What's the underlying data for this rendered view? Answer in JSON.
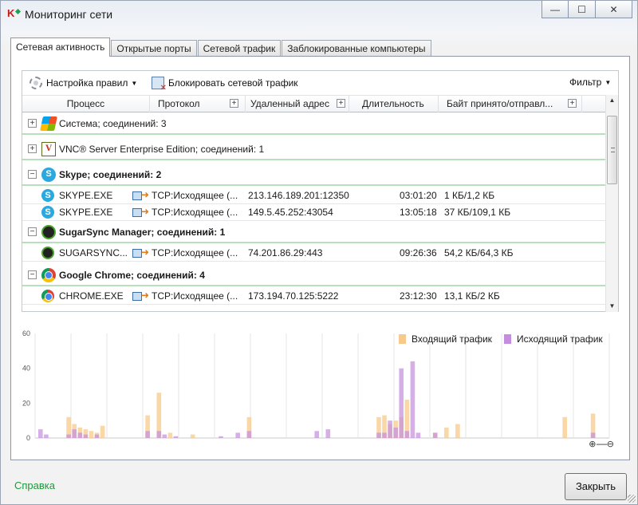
{
  "window": {
    "title": "Мониторинг сети",
    "controls": {
      "minimize": "—",
      "maximize": "☐",
      "close": "✕"
    }
  },
  "tabs": [
    {
      "label": "Сетевая активность",
      "active": true
    },
    {
      "label": "Открытые порты",
      "active": false
    },
    {
      "label": "Сетевой трафик",
      "active": false
    },
    {
      "label": "Заблокированные компьютеры",
      "active": false
    }
  ],
  "toolbar": {
    "rules_label": "Настройка правил",
    "block_label": "Блокировать сетевой трафик",
    "filter_label": "Фильтр"
  },
  "columns": {
    "process": "Процесс",
    "protocol": "Протокол",
    "remote": "Удаленный адрес",
    "duration": "Длительность",
    "bytes": "Байт принято/отправл..."
  },
  "groups": [
    {
      "name": "Система; соединений: 3",
      "icon": "windows-icon",
      "expanded": false
    },
    {
      "name": "VNC® Server Enterprise Edition; соединений: 1",
      "icon": "vnc-icon",
      "expanded": false
    },
    {
      "name": "Skype; соединений: 2",
      "icon": "skype-icon",
      "expanded": true
    },
    {
      "name": "SugarSync Manager; соединений: 1",
      "icon": "sugarsync-icon",
      "expanded": true
    },
    {
      "name": "Google Chrome; соединений: 4",
      "icon": "chrome-icon",
      "expanded": true
    }
  ],
  "connections": [
    {
      "process": "SKYPE.EXE",
      "protocol": "TCP:Исходящее (...",
      "remote": "213.146.189.201:12350",
      "duration": "03:01:20",
      "bytes": "1 КБ/1,2 КБ",
      "icon": "skype-icon"
    },
    {
      "process": "SKYPE.EXE",
      "protocol": "TCP:Исходящее (...",
      "remote": "149.5.45.252:43054",
      "duration": "13:05:18",
      "bytes": "37 КБ/109,1 КБ",
      "icon": "skype-icon"
    },
    {
      "process": "SUGARSYNC...",
      "protocol": "TCP:Исходящее (...",
      "remote": "74.201.86.29:443",
      "duration": "09:26:36",
      "bytes": "54,2 КБ/64,3 КБ",
      "icon": "sugarsync-icon"
    },
    {
      "process": "CHROME.EXE",
      "protocol": "TCP:Исходящее (...",
      "remote": "173.194.70.125:5222",
      "duration": "23:12:30",
      "bytes": "13,1 КБ/2 КБ",
      "icon": "chrome-icon"
    }
  ],
  "chart_data": {
    "type": "bar",
    "title": "",
    "xlabel": "",
    "ylabel": "",
    "ylim": [
      0,
      60
    ],
    "yticks": [
      "0",
      "20",
      "40",
      "60"
    ],
    "grid": true,
    "legend_position": "top-right",
    "series": [
      {
        "name": "Входящий трафик",
        "color": "#f7c98a",
        "values": [
          0,
          0,
          0,
          0,
          0,
          12,
          8,
          6,
          5,
          4,
          3,
          7,
          0,
          0,
          0,
          0,
          0,
          0,
          0,
          13,
          0,
          26,
          0,
          3,
          0,
          0,
          0,
          2,
          0,
          0,
          0,
          0,
          0,
          0,
          0,
          0,
          0,
          12,
          0,
          0,
          0,
          0,
          0,
          0,
          0,
          0,
          0,
          0,
          0,
          0,
          0,
          0,
          0,
          0,
          0,
          0,
          0,
          0,
          0,
          0,
          12,
          13,
          8,
          10,
          12,
          22,
          0,
          0,
          0,
          0,
          3,
          0,
          6,
          0,
          8,
          0,
          0,
          0,
          0,
          0,
          0,
          0,
          0,
          0,
          0,
          0,
          0,
          0,
          0,
          0,
          0,
          0,
          0,
          12,
          0,
          0,
          0,
          0,
          14,
          0,
          0
        ]
      },
      {
        "name": "Исходящий трафик",
        "color": "#c48de0",
        "values": [
          5,
          2,
          0,
          0,
          0,
          2,
          5,
          3,
          2,
          0,
          2,
          0,
          0,
          0,
          0,
          0,
          0,
          0,
          0,
          4,
          0,
          4,
          2,
          0,
          1,
          0,
          0,
          0,
          0,
          0,
          0,
          0,
          1,
          0,
          0,
          3,
          0,
          4,
          0,
          0,
          0,
          0,
          0,
          0,
          0,
          0,
          0,
          0,
          0,
          4,
          0,
          5,
          0,
          0,
          0,
          0,
          0,
          0,
          0,
          0,
          3,
          3,
          10,
          6,
          40,
          4,
          44,
          3,
          0,
          0,
          3,
          0,
          0,
          0,
          0,
          0,
          0,
          0,
          0,
          0,
          0,
          0,
          0,
          0,
          0,
          0,
          0,
          0,
          0,
          0,
          0,
          0,
          0,
          0,
          0,
          0,
          0,
          0,
          3,
          0,
          0
        ]
      }
    ]
  },
  "footer": {
    "help_label": "Справка",
    "close_label": "Закрыть"
  }
}
